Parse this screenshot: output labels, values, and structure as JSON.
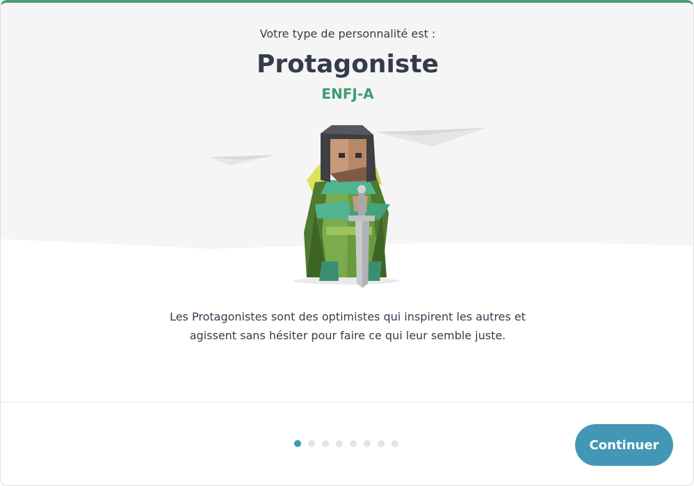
{
  "result": {
    "intro": "Votre type de personnalité est :",
    "type_name": "Protagoniste",
    "type_code": "ENFJ-A",
    "description": "Les Protagonistes sont des optimistes qui inspirent les autres et agissent sans hésiter pour faire ce qui leur semble juste."
  },
  "illustration": {
    "icon": "protagonist-knight-illustration"
  },
  "pagination": {
    "total": 8,
    "active_index": 0
  },
  "footer": {
    "continue_label": "Continuer"
  },
  "colors": {
    "accent": "#4298b4",
    "type_green": "#3d9c72",
    "top_border": "#4a9e74",
    "sky": "#f5f5f5",
    "text": "#343c4b"
  }
}
